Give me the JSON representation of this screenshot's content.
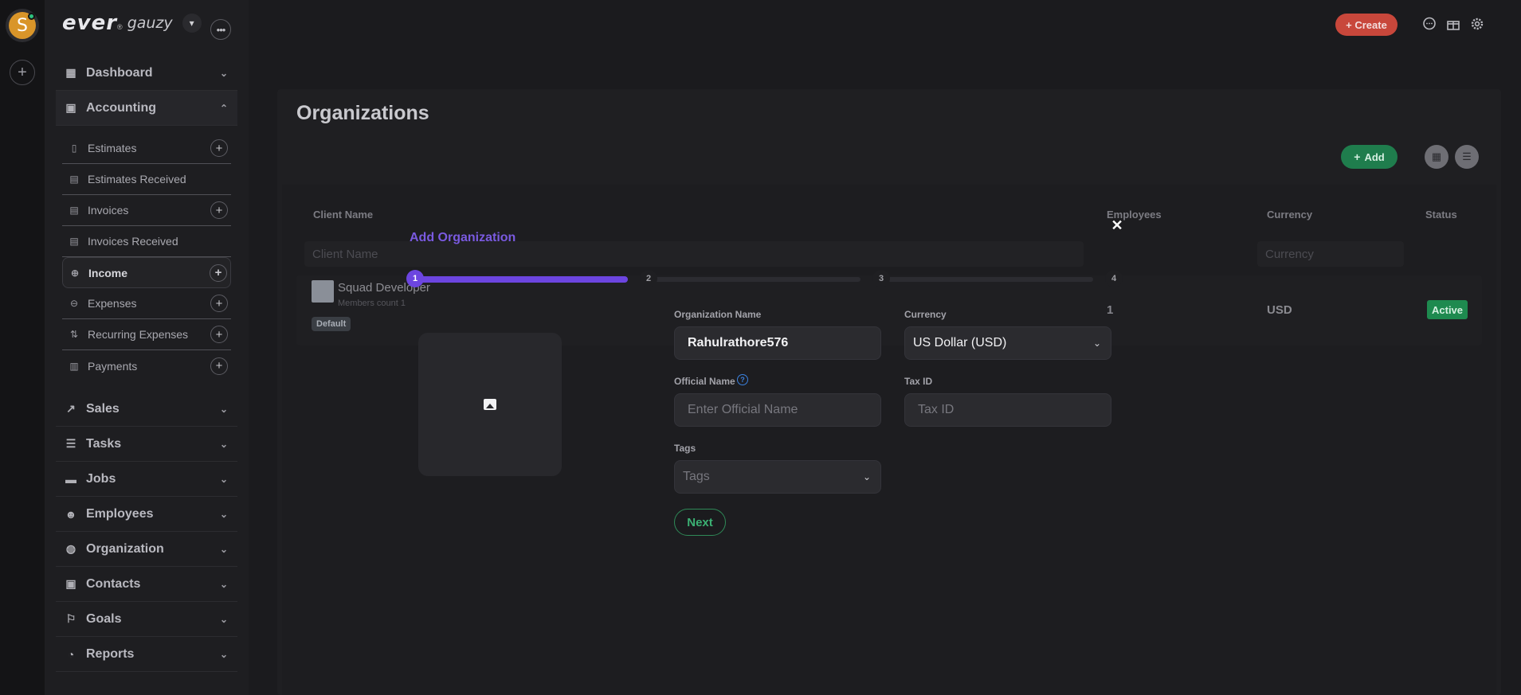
{
  "app": {
    "logo_main": "ever",
    "logo_reg": "®",
    "logo_sub": "gauzy",
    "avatar_letter": "S",
    "more_label": "•••"
  },
  "header": {
    "create_label": "+ Create"
  },
  "sidebar": {
    "items": [
      {
        "label": "Dashboard",
        "icon": "grid-icon"
      },
      {
        "label": "Accounting",
        "icon": "id-card-icon"
      },
      {
        "label": "Sales",
        "icon": "chart-line-icon"
      },
      {
        "label": "Tasks",
        "icon": "tasks-icon"
      },
      {
        "label": "Jobs",
        "icon": "briefcase-icon"
      },
      {
        "label": "Employees",
        "icon": "users-icon"
      },
      {
        "label": "Organization",
        "icon": "globe-icon"
      },
      {
        "label": "Contacts",
        "icon": "contact-card-icon"
      },
      {
        "label": "Goals",
        "icon": "flag-icon"
      },
      {
        "label": "Reports",
        "icon": "pie-chart-icon"
      }
    ],
    "accounting_sub": [
      {
        "label": "Estimates",
        "has_add": true
      },
      {
        "label": "Estimates Received",
        "has_add": false
      },
      {
        "label": "Invoices",
        "has_add": true
      },
      {
        "label": "Invoices Received",
        "has_add": false
      },
      {
        "label": "Income",
        "has_add": true,
        "selected": true
      },
      {
        "label": "Expenses",
        "has_add": true
      },
      {
        "label": "Recurring Expenses",
        "has_add": true
      },
      {
        "label": "Payments",
        "has_add": true
      }
    ]
  },
  "page": {
    "title": "Organizations",
    "add_label": "Add"
  },
  "table": {
    "columns": [
      "Client Name",
      "Employees",
      "Currency",
      "Status"
    ],
    "filters": {
      "client_name": "Client Name",
      "currency": "Currency"
    },
    "rows": [
      {
        "name": "Squad Developer",
        "members": "Members count 1",
        "badge": "Default",
        "employees": "1",
        "currency": "USD",
        "status": "Active"
      }
    ]
  },
  "dialog": {
    "title": "Add Organization",
    "close": "✕",
    "steps": [
      "1",
      "2",
      "3",
      "4"
    ],
    "current_step": 1,
    "fields": {
      "org_name_label": "Organization Name",
      "org_name_value": "Rahulrathore576",
      "currency_label": "Currency",
      "currency_value": "US Dollar (USD)",
      "official_name_label": "Official Name",
      "official_name_placeholder": "Enter Official Name",
      "tax_id_label": "Tax ID",
      "tax_id_placeholder": "Tax ID",
      "tags_label": "Tags",
      "tags_placeholder": "Tags"
    },
    "next_label": "Next"
  },
  "colors": {
    "accent_purple": "#6c45e0",
    "create_red": "#c8473b",
    "success_green": "#1e8a4f"
  }
}
